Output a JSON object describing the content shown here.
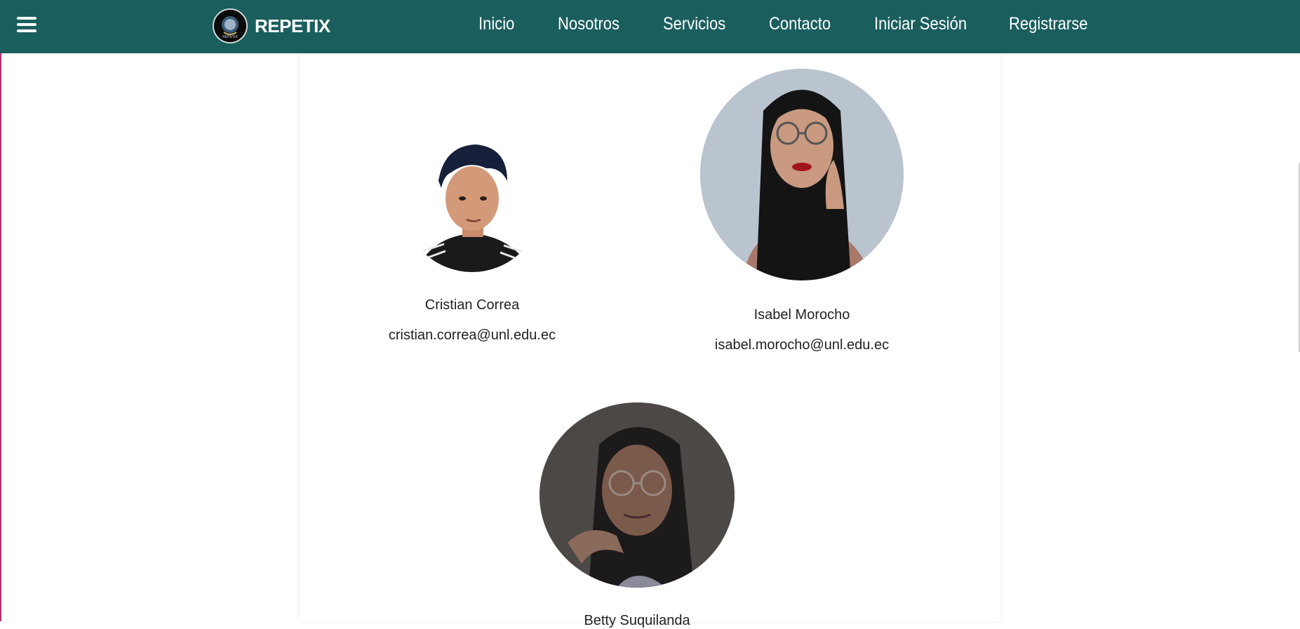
{
  "navbar": {
    "brand": "REPETIX",
    "links": [
      "Inicio",
      "Nosotros",
      "Servicios",
      "Contacto",
      "Iniciar Sesión",
      "Registrarse"
    ]
  },
  "team": {
    "members": [
      {
        "name": "Cristian Correa",
        "email": "cristian.correa@unl.edu.ec"
      },
      {
        "name": "Isabel Morocho",
        "email": "isabel.morocho@unl.edu.ec"
      },
      {
        "name": "Betty Suquilanda",
        "email": ""
      }
    ]
  },
  "colors": {
    "navbar_bg": "#1b5e5e",
    "text": "#222222"
  }
}
